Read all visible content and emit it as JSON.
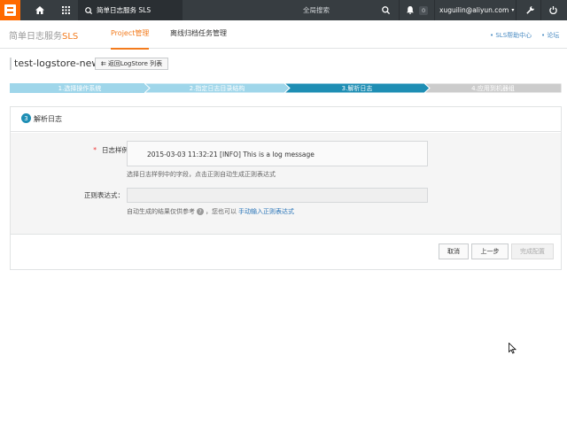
{
  "topbar": {
    "tab_label": "简单日志服务 SLS",
    "search_placeholder": "全局搜索",
    "notification_count": "0",
    "user": "xuguilin@aliyun.com",
    "accent_color": "#ff6a00"
  },
  "subnav": {
    "brand_prefix": "简单日志服务",
    "brand_suffix": "SLS",
    "items": [
      {
        "label": "Project管理",
        "active": true
      },
      {
        "label": "离线归档任务管理",
        "active": false
      }
    ],
    "help_link": "SLS帮助中心",
    "forum_link": "论坛"
  },
  "page": {
    "title": "test-logstore-new",
    "back_button": "返回LogStore 列表"
  },
  "steps": [
    {
      "label": "1.选择操作系统",
      "state": "done"
    },
    {
      "label": "2.指定日志目录结构",
      "state": "done"
    },
    {
      "label": "3.解析日志",
      "state": "current"
    },
    {
      "label": "4.应用到机器组",
      "state": "todo"
    }
  ],
  "panel": {
    "step_number": "3",
    "title": "解析日志",
    "sample_label": "日志样例",
    "sample_required": "*",
    "sample_value": "2015-03-03 11:32:21 [INFO] This is a log message",
    "sample_hint": "选择日志样例中的字段，点击正则自动生成正则表达式",
    "regex_label": "正则表达式：",
    "regex_value": "",
    "regex_hint_prefix": "自动生成的结果仅供参考",
    "regex_hint_middle": "，您也可以",
    "regex_hint_link": "手动输入正则表达式"
  },
  "buttons": {
    "cancel": "取消",
    "prev": "上一步",
    "finish": "完成配置"
  },
  "colors": {
    "step_done": "#9fd6ea",
    "step_current": "#1e8eb4",
    "step_todo": "#cccccc",
    "brand_orange": "#f37b1d"
  }
}
